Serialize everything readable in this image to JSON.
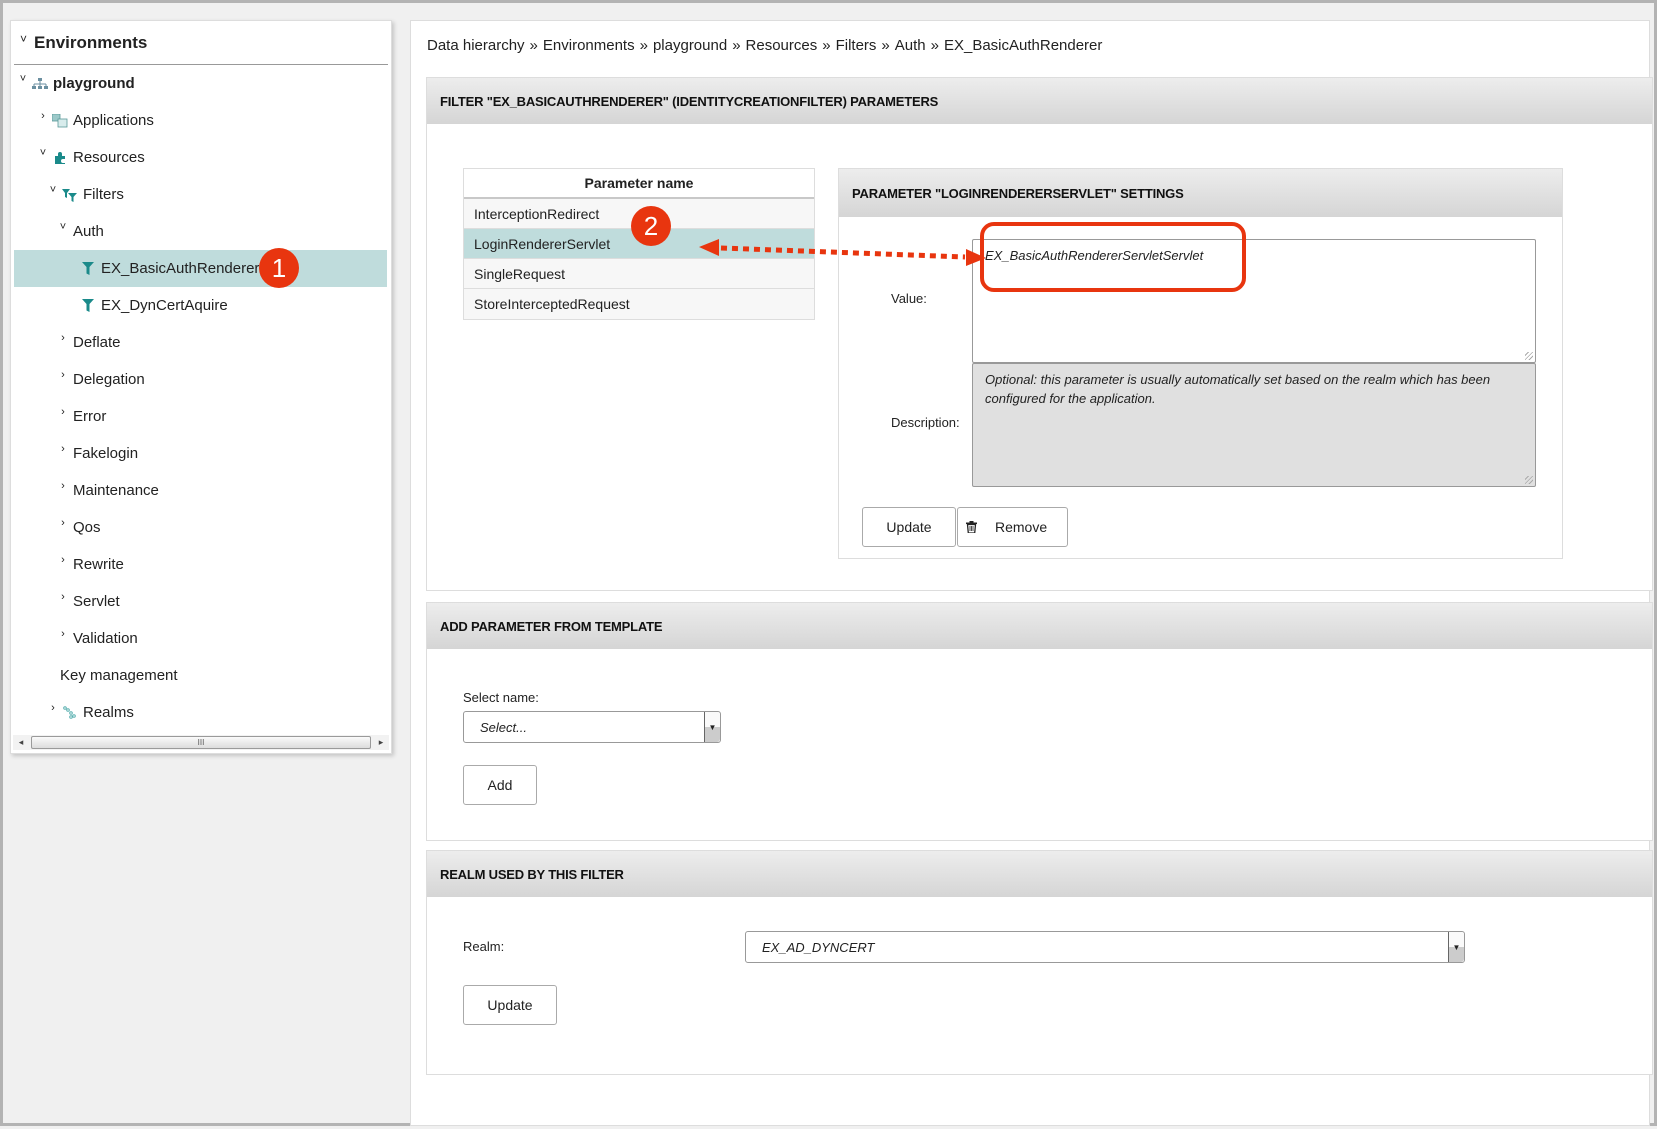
{
  "sidebar": {
    "title": "Environments",
    "items": [
      {
        "label": "playground",
        "toggle": "˅",
        "icon": "environment-network-icon",
        "bold": true
      },
      {
        "label": "Applications",
        "toggle": "›",
        "icon": "applications-icon"
      },
      {
        "label": "Resources",
        "toggle": "˅",
        "icon": "resources-puzzle-icon"
      },
      {
        "label": "Filters",
        "toggle": "˅",
        "icon": "filters-icon"
      },
      {
        "label": "Auth",
        "toggle": "˅"
      },
      {
        "label": "EX_BasicAuthRenderer",
        "icon": "filter-icon",
        "selected": true
      },
      {
        "label": "EX_DynCertAquire",
        "icon": "filter-icon"
      },
      {
        "label": "Deflate",
        "toggle": "›"
      },
      {
        "label": "Delegation",
        "toggle": "›"
      },
      {
        "label": "Error",
        "toggle": "›"
      },
      {
        "label": "Fakelogin",
        "toggle": "›"
      },
      {
        "label": "Maintenance",
        "toggle": "›"
      },
      {
        "label": "Qos",
        "toggle": "›"
      },
      {
        "label": "Rewrite",
        "toggle": "›"
      },
      {
        "label": "Servlet",
        "toggle": "›"
      },
      {
        "label": "Validation",
        "toggle": "›"
      },
      {
        "label": "Key management"
      },
      {
        "label": "Realms",
        "toggle": "›",
        "icon": "realms-icon"
      }
    ],
    "scroll_thumb_glyph": "III"
  },
  "breadcrumb": [
    "Data hierarchy",
    "Environments",
    "playground",
    "Resources",
    "Filters",
    "Auth",
    "EX_BasicAuthRenderer"
  ],
  "breadcrumb_separator": "»",
  "filter_panel": {
    "title": "FILTER \"EX_BASICAUTHRENDERER\" (IDENTITYCREATIONFILTER) PARAMETERS",
    "table_header": "Parameter name",
    "parameters": [
      "InterceptionRedirect",
      "LoginRendererServlet",
      "SingleRequest",
      "StoreInterceptedRequest"
    ],
    "selected_parameter": "LoginRendererServlet",
    "settings": {
      "title": "PARAMETER \"LOGINRENDERERSERVLET\" SETTINGS",
      "value_label": "Value:",
      "value": "EX_BasicAuthRendererServletServlet",
      "description_label": "Description:",
      "description": "Optional: this parameter is usually automatically set based on the realm which has been configured for the application.",
      "update_label": "Update",
      "remove_label": "Remove"
    }
  },
  "template_panel": {
    "title": "ADD PARAMETER FROM TEMPLATE",
    "select_label": "Select name:",
    "select_value": "Select...",
    "add_label": "Add"
  },
  "realm_panel": {
    "title": "REALM USED BY THIS FILTER",
    "realm_label": "Realm:",
    "realm_value": "EX_AD_DYNCERT",
    "update_label": "Update"
  },
  "annotations": {
    "badge_1": "1",
    "badge_2": "2",
    "color": "#e8350f"
  },
  "colors": {
    "selected_row": "#bfdcdc",
    "icon_teal": "#1a8a8a",
    "annotation_red": "#e8350f"
  }
}
